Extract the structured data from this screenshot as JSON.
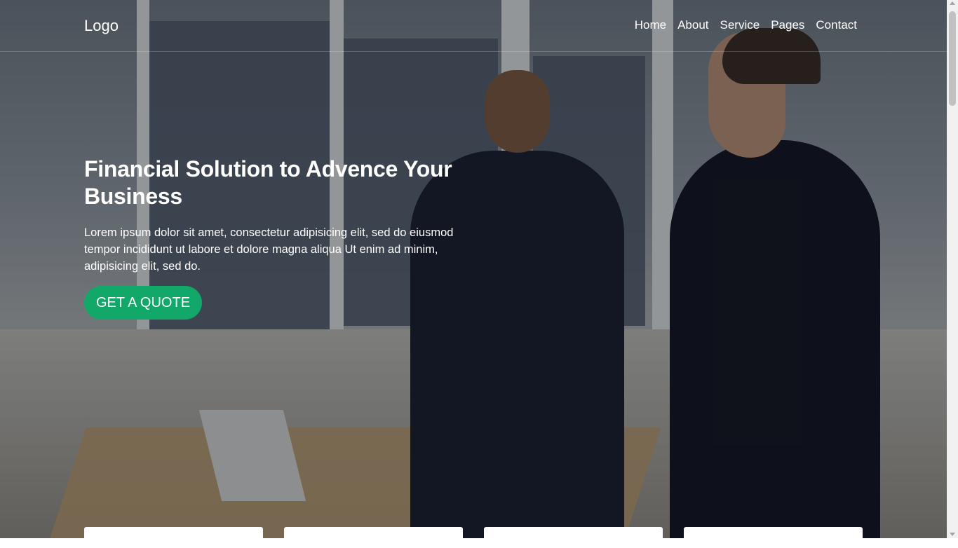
{
  "navbar": {
    "logo": "Logo",
    "links": [
      "Home",
      "About",
      "Service",
      "Pages",
      "Contact"
    ]
  },
  "hero": {
    "title": "Financial Solution to Advence Your Business",
    "description": "Lorem ipsum dolor sit amet, consectetur adipisicing elit, sed do eiusmod tempor incididunt ut labore et dolore magna aliqua Ut enim ad minim, adipisicing elit, sed do.",
    "cta_label": "GET A QUOTE",
    "image_description": "two businessmen talking in an office"
  },
  "colors": {
    "accent": "#12a86a",
    "overlay": "rgba(0,0,0,0.32)"
  }
}
